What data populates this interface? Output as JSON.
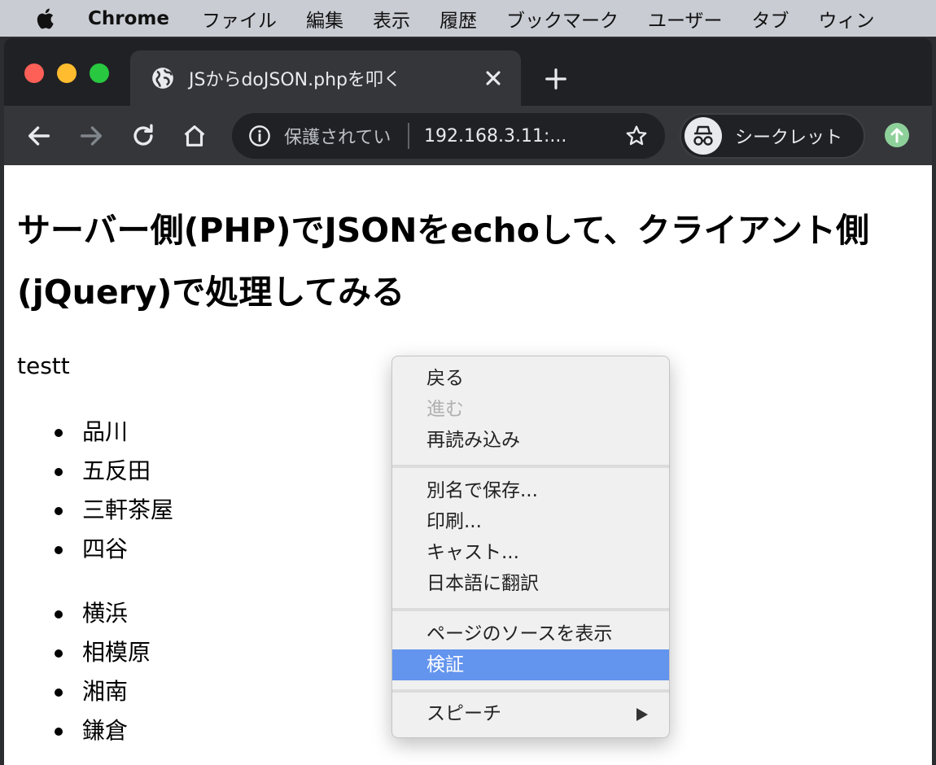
{
  "menubar": {
    "app_name": "Chrome",
    "items": [
      "ファイル",
      "編集",
      "表示",
      "履歴",
      "ブックマーク",
      "ユーザー",
      "タブ",
      "ウィン"
    ]
  },
  "tab": {
    "title": "JSからdoJSON.phpを叩く"
  },
  "omnibox": {
    "security_text": "保護されてい",
    "url": "192.168.3.11:..."
  },
  "profile": {
    "label": "シークレット"
  },
  "page": {
    "heading": "サーバー側(PHP)でJSONをechoして、クライアント側(jQuery)で処理してみる",
    "paragraph": "testt",
    "list1": [
      "品川",
      "五反田",
      "三軒茶屋",
      "四谷"
    ],
    "list2": [
      "横浜",
      "相模原",
      "湘南",
      "鎌倉"
    ]
  },
  "context_menu": {
    "back": "戻る",
    "forward": "進む",
    "reload": "再読み込み",
    "save_as": "別名で保存...",
    "print": "印刷...",
    "cast": "キャスト...",
    "translate": "日本語に翻訳",
    "view_source": "ページのソースを表示",
    "inspect": "検証",
    "speech": "スピーチ"
  },
  "colors": {
    "menu_highlight": "#6394ee",
    "update_badge": "#8ed09a"
  }
}
